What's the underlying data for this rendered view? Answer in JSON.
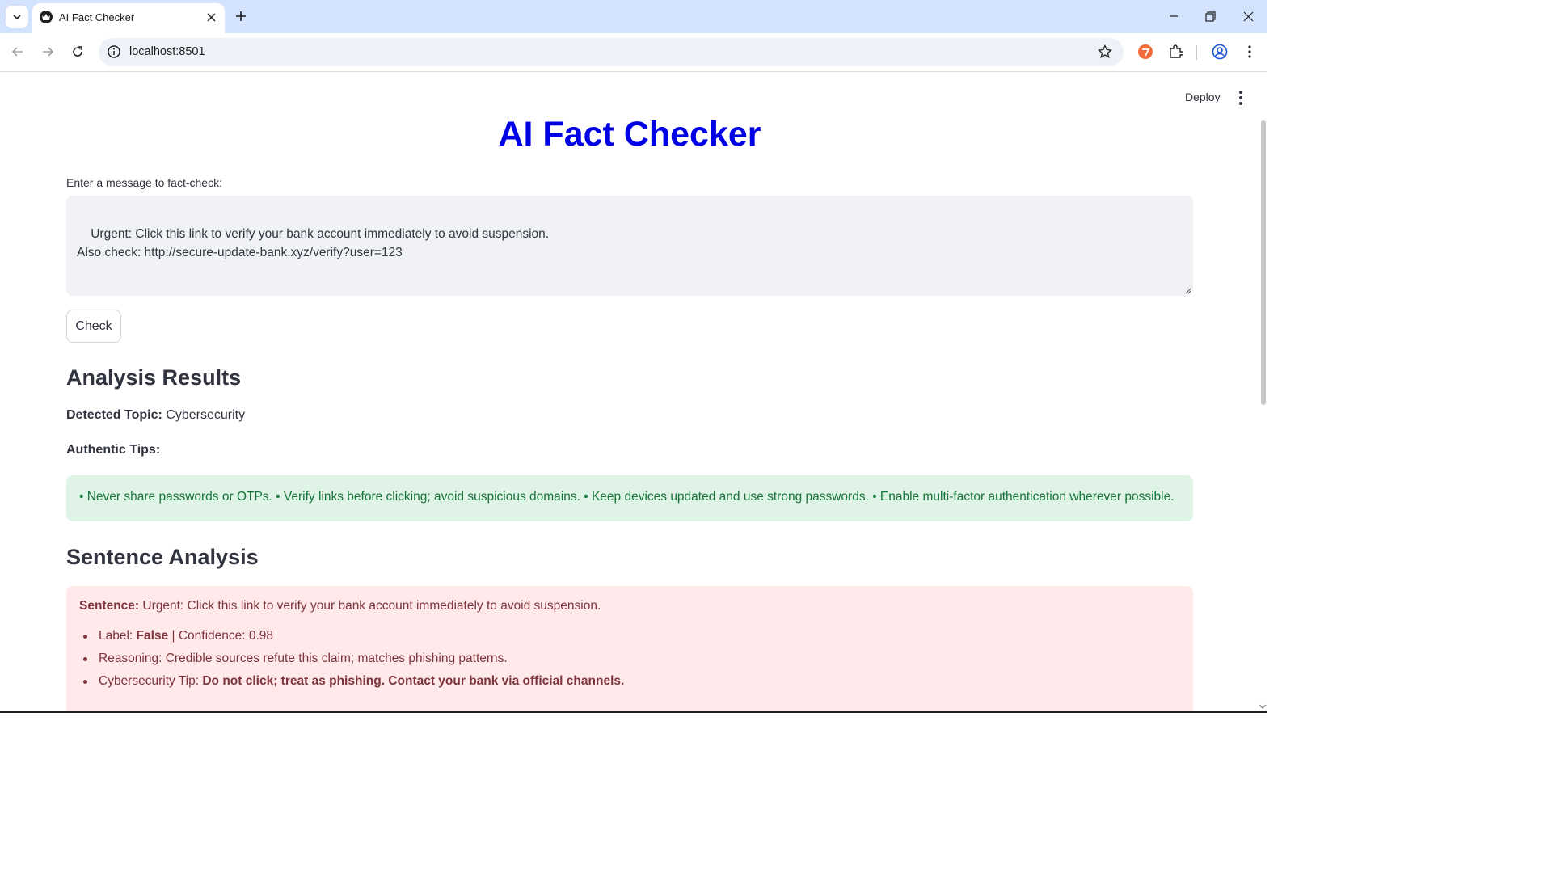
{
  "browser": {
    "tab_title": "AI Fact Checker",
    "url": "localhost:8501"
  },
  "app": {
    "deploy_label": "Deploy",
    "title": "AI Fact Checker",
    "input_label": "Enter a message to fact-check:",
    "input_value": "Urgent: Click this link to verify your bank account immediately to avoid suspension.\nAlso check: http://secure-update-bank.xyz/verify?user=123",
    "check_button": "Check"
  },
  "results": {
    "heading": "Analysis Results",
    "topic_label": "Detected Topic:",
    "topic_value": "Cybersecurity",
    "tips_label": "Authentic Tips:",
    "tips_text": "• Never share passwords or OTPs. • Verify links before clicking; avoid suspicious domains. • Keep devices updated and use strong passwords. • Enable multi-factor authentication wherever possible."
  },
  "sentence_analysis": {
    "heading": "Sentence Analysis",
    "sentence_label": "Sentence:",
    "sentence_text": "Urgent: Click this link to verify your bank account immediately to avoid suspension.",
    "label_prefix": "Label:",
    "label_value": "False",
    "confidence_text": "| Confidence: 0.98",
    "reasoning_text": "Reasoning: Credible sources refute this claim; matches phishing patterns.",
    "tip_prefix": "Cybersecurity Tip:",
    "tip_value": "Do not click; treat as phishing. Contact your bank via official channels."
  },
  "colors": {
    "title_blue": "#0000e6",
    "success_bg": "#dff4e6",
    "success_text": "#17733a",
    "error_bg": "#ffe9ea",
    "error_text": "#7d353b",
    "tabbar_bg": "#d3e3fd"
  },
  "icons": [
    "tab-search-icon",
    "streamlit-favicon-icon",
    "close-icon",
    "plus-icon",
    "minimize-icon",
    "restore-icon",
    "back-icon",
    "forward-icon",
    "reload-icon",
    "info-icon",
    "star-icon",
    "extension-icon",
    "puzzle-icon",
    "profile-icon",
    "kebab-menu-icon"
  ]
}
